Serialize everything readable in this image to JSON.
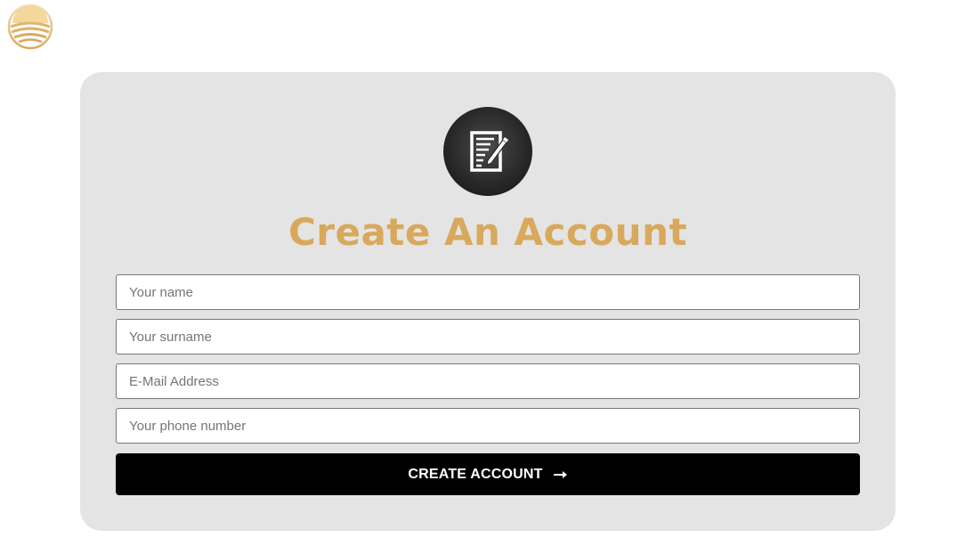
{
  "logo": {
    "icon": "sun-horizon-logo-icon",
    "colors": [
      "#e9c07a",
      "#f4dba4",
      "#d8a95c"
    ]
  },
  "form": {
    "icon": "signup-form-icon",
    "title": "Create An Account",
    "fields": {
      "name_placeholder": "Your name",
      "surname_placeholder": "Your surname",
      "email_placeholder": "E-Mail Address",
      "phone_placeholder": "Your phone number"
    },
    "submit_label": "CREATE ACCOUNT",
    "submit_icon": "arrow-right-icon"
  },
  "colors": {
    "card_background": "#e4e4e4",
    "title": "#d8a95c",
    "button": "#000000"
  }
}
